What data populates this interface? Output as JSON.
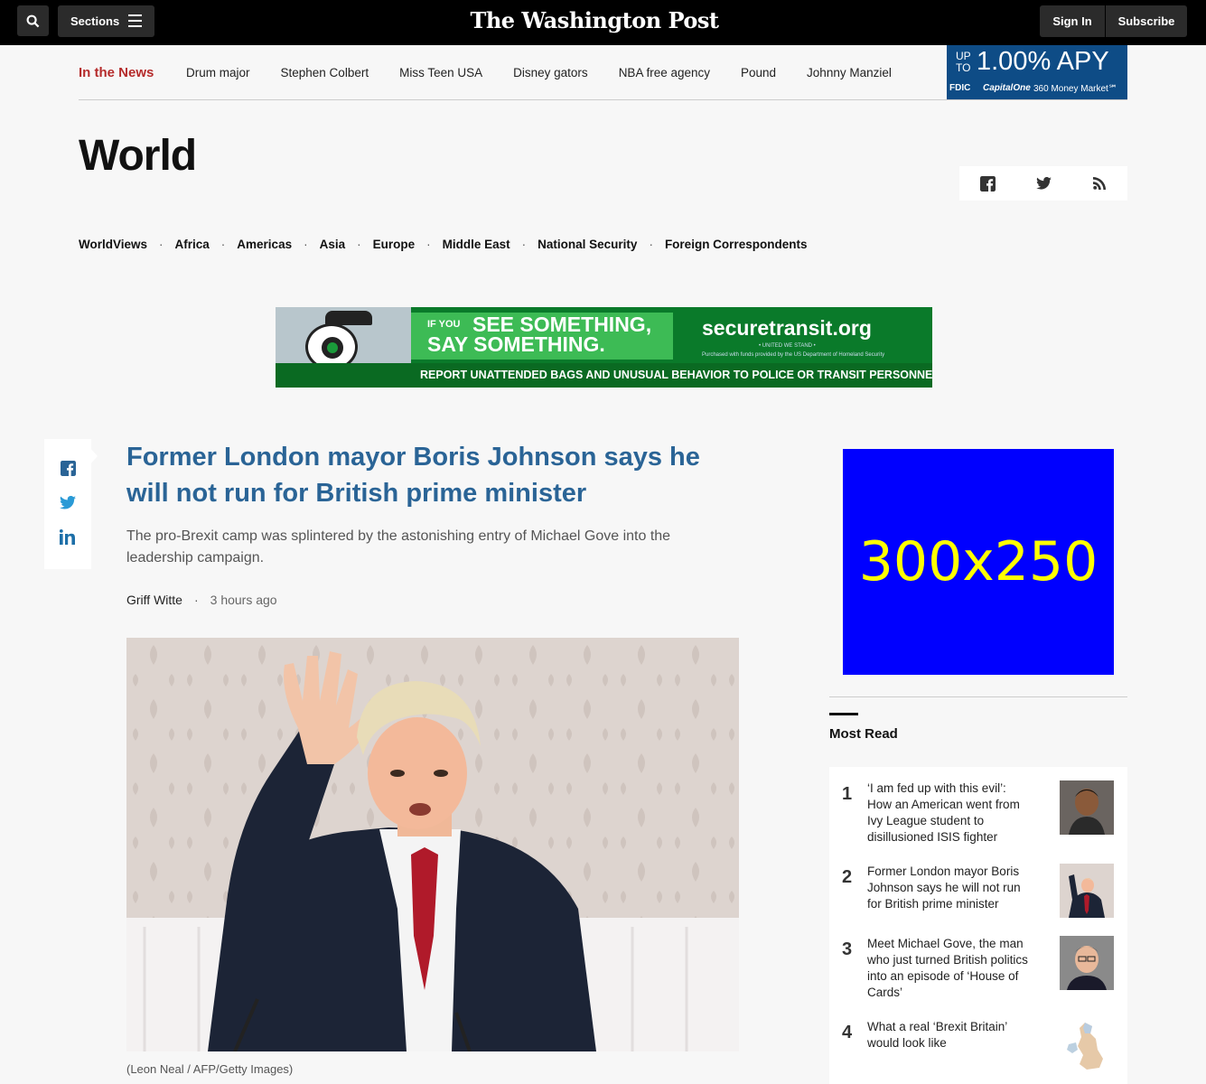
{
  "topbar": {
    "sections_label": "Sections",
    "logo_text": "The Washington Post",
    "signin_label": "Sign In",
    "subscribe_label": "Subscribe"
  },
  "in_the_news": {
    "label": "In the News",
    "links": [
      "Drum major",
      "Stephen Colbert",
      "Miss Teen USA",
      "Disney gators",
      "NBA free agency",
      "Pound",
      "Johnny Manziel"
    ]
  },
  "capital_one_ad": {
    "upto": "UP TO",
    "apy": "1.00% APY",
    "fdic": "FDIC",
    "brand": "CapitalOne",
    "product": "360 Money Market℠"
  },
  "section": {
    "title": "World",
    "subnav": [
      "WorldViews",
      "Africa",
      "Americas",
      "Asia",
      "Europe",
      "Middle East",
      "National Security",
      "Foreign Correspondents"
    ]
  },
  "banner_ad": {
    "if_you": "IF YOU",
    "line1": "SEE SOMETHING,",
    "line2": "SAY SOMETHING.",
    "site": "securetransit.org",
    "united": "• UNITED WE STAND •",
    "purchased": "Purchased with funds provided by the US Department of Homeland Security",
    "report": "REPORT UNATTENDED BAGS  AND UNUSUAL BEHAVIOR TO POLICE OR TRANSIT PERSONNEL"
  },
  "article": {
    "headline": "Former London mayor Boris Johnson says he will not run for British prime minister",
    "dek": "The pro-Brexit camp was splintered by the astonishing entry of Michael Gove into the leadership campaign.",
    "author": "Griff Witte",
    "time": "3 hours ago",
    "caption": "(Leon Neal / AFP/Getty Images)"
  },
  "rail_ad": {
    "label": "300x250"
  },
  "most_read": {
    "title": "Most Read",
    "items": [
      {
        "num": "1",
        "text": "‘I am fed up with this evil’: How an American went from Ivy League student to disillusioned ISIS fighter"
      },
      {
        "num": "2",
        "text": "Former London mayor Boris Johnson says he will not run for British prime minister"
      },
      {
        "num": "3",
        "text": "Meet Michael Gove, the man who just turned British politics into an episode of ‘House of Cards’"
      },
      {
        "num": "4",
        "text": "What a real ‘Brexit Britain’ would look like"
      }
    ]
  },
  "colors": {
    "topbar": "#000000",
    "headline": "#2a6496",
    "in_the_news": "#b52b2b",
    "rail_ad_bg": "#0000ff",
    "rail_ad_text": "#ffff00"
  }
}
